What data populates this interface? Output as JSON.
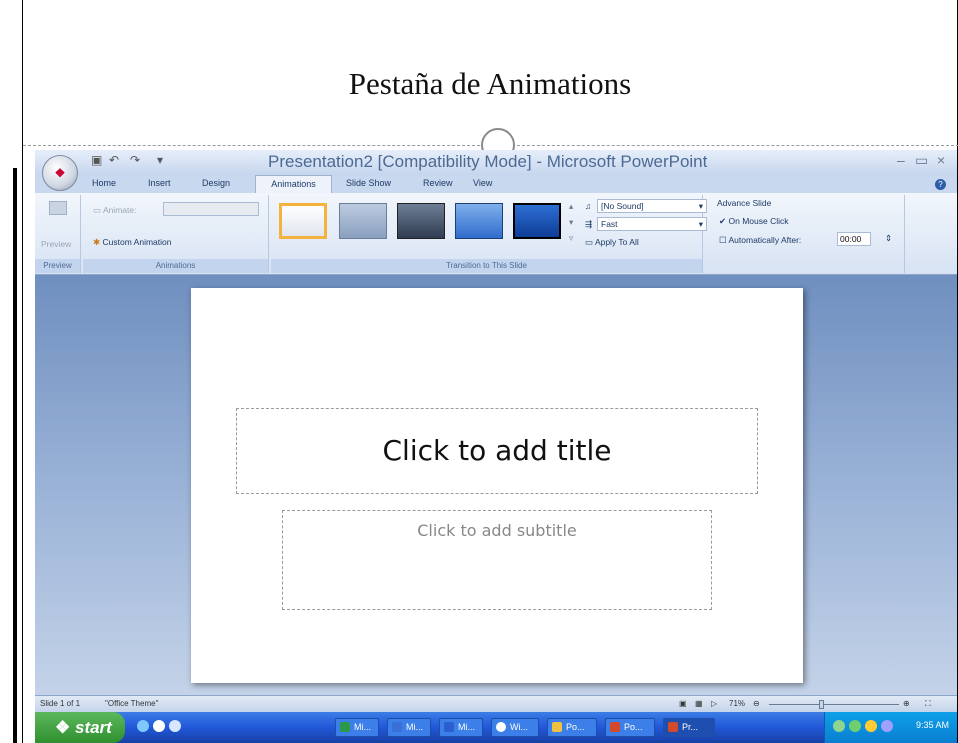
{
  "slide_heading": "Pestaña de Animations",
  "app": {
    "title": "Presentation2 [Compatibility Mode] - Microsoft PowerPoint",
    "window_controls": [
      "–",
      "▭",
      "×"
    ]
  },
  "tabs": [
    "Home",
    "Insert",
    "Design",
    "Animations",
    "Slide Show",
    "Review",
    "View"
  ],
  "ribbon": {
    "preview": {
      "button": "Preview",
      "group": "Preview"
    },
    "animations": {
      "animate_label": "Animate:",
      "custom_animation": "Custom Animation",
      "group": "Animations"
    },
    "transition": {
      "sound": "[No Sound]",
      "speed": "Fast",
      "apply_all": "Apply To All",
      "group": "Transition to This Slide"
    },
    "advance": {
      "heading": "Advance Slide",
      "on_mouse_click": "On Mouse Click",
      "auto_after": "Automatically After:",
      "time": "00:00"
    }
  },
  "slide": {
    "title_placeholder": "Click to add title",
    "subtitle_placeholder": "Click to add subtitle"
  },
  "status": {
    "slide_of": "Slide 1 of 1",
    "theme": "\"Office Theme\"",
    "zoom": "71%"
  },
  "taskbar": {
    "start": "start",
    "buttons": [
      "Mi...",
      "Mi...",
      "Mi...",
      "Wi...",
      "Po...",
      "Po...",
      "Pr..."
    ],
    "clock": "9:35 AM"
  },
  "colors": {
    "ribbon_accent": "#c3d5ee",
    "taskbar": "#2157d8",
    "start_green": "#3a9a3a"
  }
}
